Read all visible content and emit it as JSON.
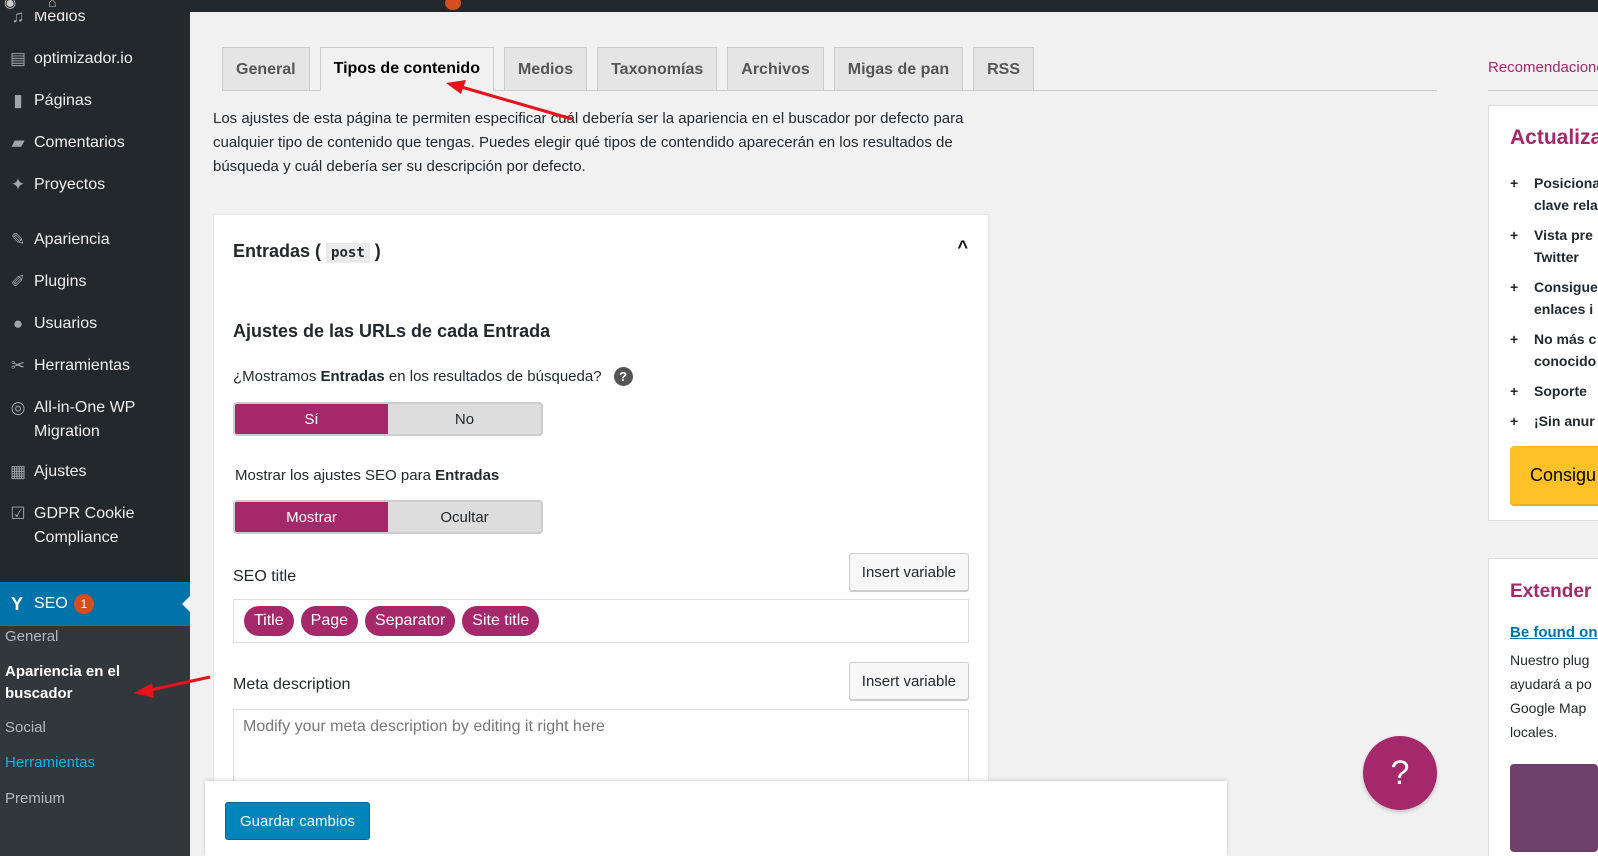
{
  "sidebar": {
    "items": [
      {
        "label": "Medios",
        "icon": "media-icon",
        "glyph": "♫"
      },
      {
        "label": "optimizador.io",
        "icon": "optimizador-icon",
        "glyph": "▤"
      },
      {
        "label": "Páginas",
        "icon": "pages-icon",
        "glyph": "▮"
      },
      {
        "label": "Comentarios",
        "icon": "comments-icon",
        "glyph": "▰"
      },
      {
        "label": "Proyectos",
        "icon": "pin-icon",
        "glyph": "✦"
      },
      {
        "label": "Apariencia",
        "icon": "appearance-icon",
        "glyph": "✎"
      },
      {
        "label": "Plugins",
        "icon": "plugins-icon",
        "glyph": "✐"
      },
      {
        "label": "Usuarios",
        "icon": "users-icon",
        "glyph": "●"
      },
      {
        "label": "Herramientas",
        "icon": "tools-icon",
        "glyph": "✂"
      },
      {
        "label": "All-in-One WP Migration",
        "icon": "migration-icon",
        "glyph": "◎"
      },
      {
        "label": "Ajustes",
        "icon": "settings-icon",
        "glyph": "▦"
      },
      {
        "label": "GDPR Cookie Compliance",
        "icon": "gdpr-icon",
        "glyph": "☑"
      }
    ],
    "seo": {
      "label": "SEO",
      "badge": "1",
      "icon": "yoast-icon",
      "glyph": "Y"
    },
    "submenu": [
      "General",
      "Apariencia en el buscador",
      "Social",
      "Herramientas",
      "Premium"
    ]
  },
  "tabs": [
    "General",
    "Tipos de contenido",
    "Medios",
    "Taxonomías",
    "Archivos",
    "Migas de pan",
    "RSS"
  ],
  "intro": "Los ajustes de esta página te permiten especificar cuál debería ser la apariencia en el buscador por defecto para cualquier tipo de contenido que tengas. Puedes elegir qué tipos de contendido aparecerán en los resultados de búsqueda y cuál debería ser su descripción por defecto.",
  "card": {
    "title_prefix": "Entradas (",
    "title_code": "post",
    "title_suffix": ")",
    "caret": "^",
    "section_heading": "Ajustes de las URLs de cada Entrada",
    "q_show_pre": "¿Mostramos ",
    "q_show_bold": "Entradas",
    "q_show_post": " en los resultados de búsqueda?",
    "help_glyph": "?",
    "toggle1": {
      "on": "Sí",
      "off": "No"
    },
    "q_seo_pre": "Mostrar los ajustes SEO para ",
    "q_seo_bold": "Entradas",
    "toggle2": {
      "on": "Mostrar",
      "off": "Ocultar"
    },
    "seo_title_label": "SEO title",
    "insert_variable": "Insert variable",
    "pills": [
      "Title",
      "Page",
      "Separator",
      "Site title"
    ],
    "meta_label": "Meta description",
    "meta_placeholder": "Modify your meta description by editing it right here"
  },
  "save_label": "Guardar cambios",
  "help_fab": "?",
  "right": {
    "recommend": "Recomendaciones",
    "upsell_title": "Actualiza",
    "bullets": [
      [
        "Posiciona",
        "clave rela"
      ],
      [
        "Vista pre",
        "Twitter"
      ],
      [
        "Consigue",
        "enlaces i"
      ],
      [
        "No más c",
        "conocido"
      ],
      [
        "Soporte"
      ],
      [
        "¡Sin anur"
      ]
    ],
    "upsell_button": "Consigu",
    "ext_title": "Extender",
    "ext_link": "Be found on",
    "ext_text": [
      "Nuestro plug",
      "ayudará a po",
      "Google Map",
      "locales."
    ]
  },
  "colors": {
    "accent": "#a4286a",
    "wp_blue": "#0073aa",
    "sidebar": "#23282d",
    "arrow": "#e8121a"
  }
}
